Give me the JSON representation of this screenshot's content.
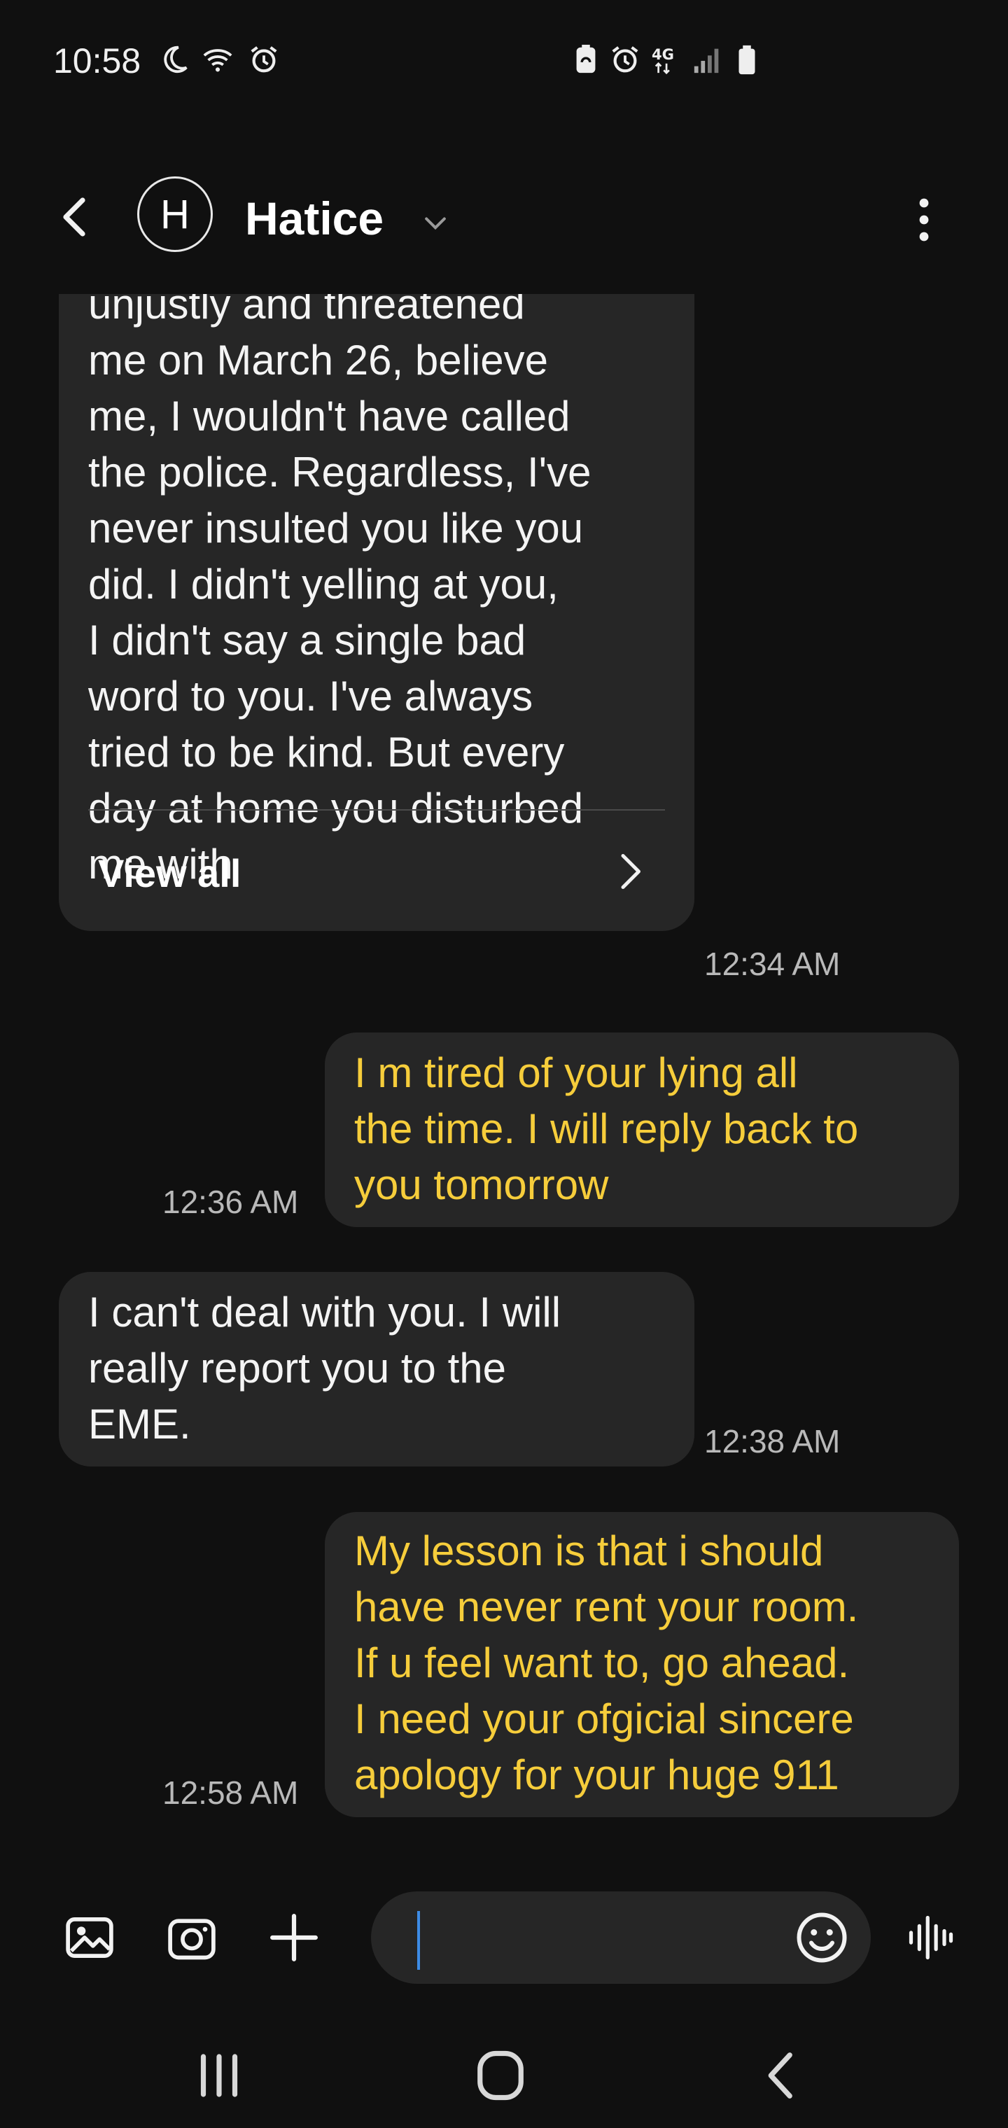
{
  "status_bar": {
    "time": "10:58",
    "left_icons": [
      "moon-icon",
      "wifi-icon",
      "alarm-icon"
    ],
    "right_icons": [
      "battery-saver-icon",
      "alarm-icon",
      "4g-lte-icon",
      "signal-icon",
      "battery-icon"
    ]
  },
  "header": {
    "avatar_initial": "H",
    "contact_name": "Hatice"
  },
  "messages": [
    {
      "direction": "incoming",
      "lines": [
        "unjustly and threatened",
        "me on March 26, believe",
        "me, I wouldn't have called",
        "the police.  Regardless, I've",
        "never insulted you like you",
        "did.  I didn't yelling at you,",
        "I didn't say a single bad",
        "word to you.  I've always",
        "tried to be kind.  But every",
        "day at home you disturbed",
        "me with"
      ],
      "view_all_label": "View all",
      "time": "12:34 AM"
    },
    {
      "direction": "outgoing",
      "lines": [
        "I m tired of your lying all",
        "the time. I will reply back to",
        "you tomorrow"
      ],
      "time": "12:36 AM"
    },
    {
      "direction": "incoming",
      "lines": [
        "I can't deal with you. I will",
        "really report you to the",
        "EME."
      ],
      "time": "12:38 AM"
    },
    {
      "direction": "outgoing",
      "lines": [
        "My lesson is that i should",
        "have never rent your room.",
        "If u feel want to, go ahead.",
        "I need your ofgicial sincere",
        "apology for your huge 911"
      ],
      "time": "12:58 AM"
    }
  ],
  "composer": {
    "input_value": "",
    "icons": [
      "gallery-icon",
      "camera-icon",
      "plus-icon",
      "emoji-icon",
      "voice-icon"
    ]
  },
  "nav_bar": {
    "icons": [
      "recent-apps-icon",
      "home-icon",
      "back-icon"
    ]
  },
  "colors": {
    "background": "#101010",
    "bubble": "#262626",
    "incoming_text": "#f4f4f4",
    "outgoing_text": "#f6cd3b",
    "timestamp": "#b9b9b9",
    "cursor": "#3d8be5"
  }
}
